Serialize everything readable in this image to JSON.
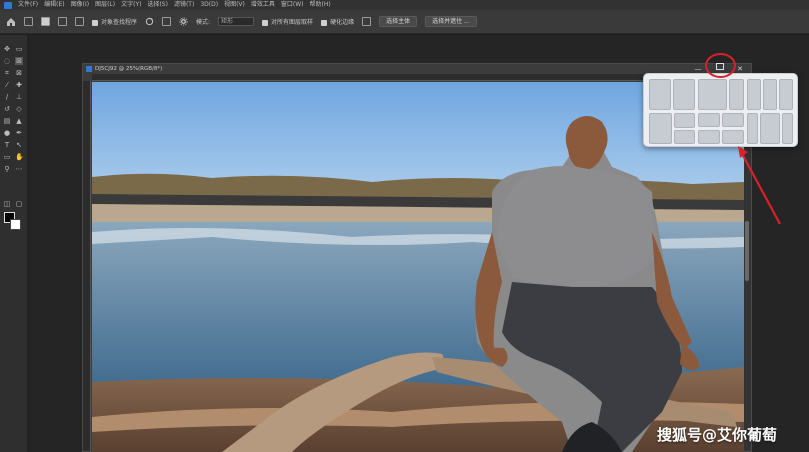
{
  "menubar": {
    "items": [
      "文件(F)",
      "编辑(E)",
      "图像(I)",
      "图层(L)",
      "文字(Y)",
      "选择(S)",
      "滤镜(T)",
      "3D(D)",
      "视图(V)",
      "增效工具",
      "窗口(W)",
      "帮助(H)"
    ]
  },
  "options": {
    "auto_select_label": "对象查找程序",
    "mode_label": "模式:",
    "mode_value": "矩形",
    "sample_all_label": "对所有图层取样",
    "enhance_edge_label": "硬化边缘",
    "select_subject": "选择主体",
    "select_mask": "选择并遮住 ..."
  },
  "document": {
    "title": "DJ5CJ92 @ 25%(RGB/8*)",
    "minimize": "—",
    "close": "✕"
  },
  "watermark": "搜狐号@艾你葡萄",
  "colors": {
    "accent": "#2d79d6",
    "annotation": "#d8222a",
    "sky": "#84b6e6",
    "water": "#6e90ad"
  },
  "icons": {
    "home": "home-icon",
    "rotate": "rotate-icon",
    "gear": "gear-icon",
    "maximize": "maximize-icon"
  }
}
